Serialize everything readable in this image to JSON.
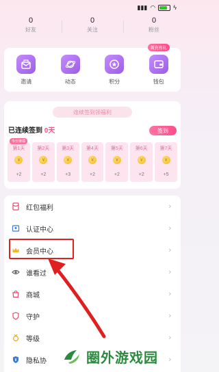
{
  "status_bar": {
    "time": "",
    "icons": [
      "signal-icon",
      "wifi-icon",
      "battery-icon",
      "charging-icon"
    ],
    "battery": "65"
  },
  "stats": [
    {
      "value": "0",
      "label": "好友"
    },
    {
      "value": "0",
      "label": "关注"
    },
    {
      "value": "0",
      "label": "粉丝"
    }
  ],
  "features": [
    {
      "label": "邀请",
      "icon": "invite-icon"
    },
    {
      "label": "动态",
      "icon": "planet-icon"
    },
    {
      "label": "积分",
      "icon": "points-icon"
    },
    {
      "label": "钱包",
      "icon": "wallet-icon",
      "badge": "首充有礼"
    }
  ],
  "signin": {
    "banner": "连续签到领福利",
    "streak_prefix": "已连续签到 ",
    "streak_days": "0天",
    "button": "签到",
    "today_tag": "今日待领",
    "days": [
      {
        "label": "第1天",
        "points": "+2"
      },
      {
        "label": "第2天",
        "points": "+2"
      },
      {
        "label": "第3天",
        "points": "+3"
      },
      {
        "label": "第4天",
        "points": "+2"
      },
      {
        "label": "第5天",
        "points": "+2"
      },
      {
        "label": "第6天",
        "points": "+2"
      },
      {
        "label": "第7天",
        "points": "+5"
      }
    ]
  },
  "menu": [
    {
      "label": "红包福利",
      "icon": "red-packet-icon"
    },
    {
      "label": "认证中心",
      "icon": "certification-icon"
    },
    {
      "label": "会员中心",
      "icon": "crown-icon"
    },
    {
      "label": "谁看过",
      "icon": "eye-icon"
    },
    {
      "label": "商城",
      "icon": "shop-icon"
    },
    {
      "label": "守护",
      "icon": "shield-icon"
    },
    {
      "label": "等级",
      "icon": "medal-icon"
    },
    {
      "label": "隐私协",
      "icon": "privacy-icon"
    }
  ],
  "colors": {
    "accent": "#ff4d88",
    "purple": "#9b5de5",
    "annotation": "#e02020"
  },
  "watermark": "圈外游戏园"
}
